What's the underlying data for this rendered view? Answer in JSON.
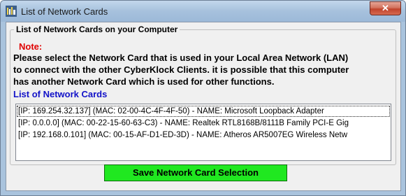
{
  "window": {
    "title": "List of Network Cards",
    "close_glyph": "✕",
    "app_icon": "network-cards-app-icon"
  },
  "group": {
    "title": "List of Network Cards on your Computer"
  },
  "note": {
    "label": "Note:",
    "message": "Please select the Network Card that is used in your Local Area Network (LAN)\nto connect with the other CyberKlock Clients. it is possible that this computer\nhas another Network Card which is used for other functions."
  },
  "list": {
    "label": "List of Network Cards",
    "items": [
      "[IP: 169.254.32.137]  (MAC: 02-00-4C-4F-4F-50) - NAME: Microsoft Loopback Adapter",
      "[IP: 0.0.0.0]  (MAC: 00-22-15-60-63-C3) - NAME: Realtek RTL8168B/8111B Family PCI-E Gig",
      "[IP: 192.168.0.101]  (MAC: 00-15-AF-D1-ED-3D) - NAME: Atheros AR5007EG Wireless Netw"
    ]
  },
  "actions": {
    "save_label": "Save Network Card Selection"
  },
  "colors": {
    "note": "#e00000",
    "list_label": "#1212c8",
    "save_button": "#20e820"
  }
}
